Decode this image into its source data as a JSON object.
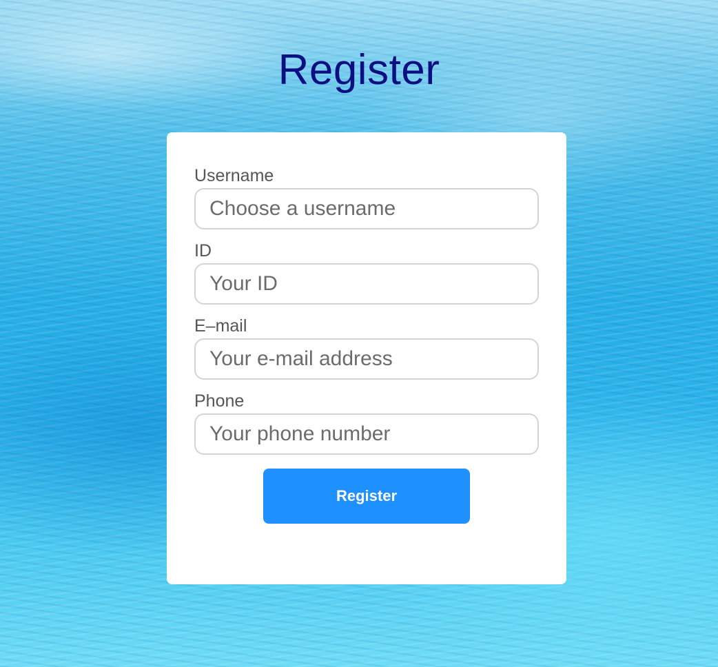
{
  "page": {
    "title": "Register"
  },
  "form": {
    "fields": [
      {
        "label": "Username",
        "placeholder": "Choose a username",
        "value": ""
      },
      {
        "label": "ID",
        "placeholder": "Your ID",
        "value": ""
      },
      {
        "label": "E–mail",
        "placeholder": "Your e-mail address",
        "value": ""
      },
      {
        "label": "Phone",
        "placeholder": "Your phone number",
        "value": ""
      }
    ],
    "submit_label": "Register"
  },
  "colors": {
    "title": "#0b0f82",
    "button": "#1e90ff",
    "card": "#ffffff",
    "label": "#555555"
  }
}
